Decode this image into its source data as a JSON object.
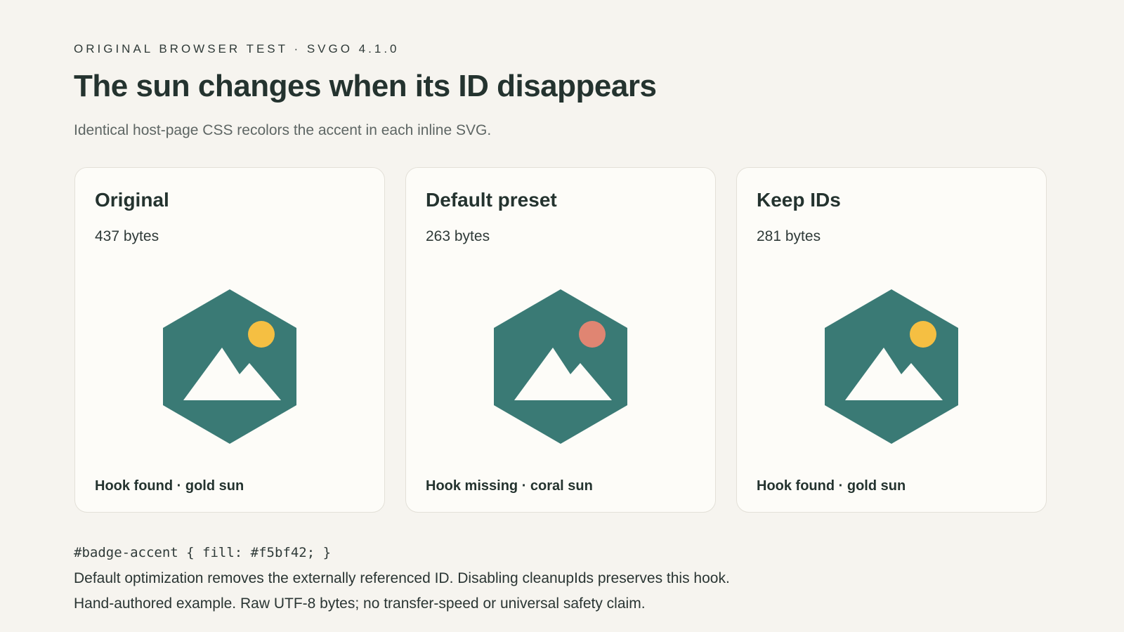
{
  "header": {
    "eyebrow": "ORIGINAL BROWSER TEST · SVGO 4.1.0",
    "title": "The sun changes when its ID disappears",
    "subtitle": "Identical host-page CSS recolors the accent in each inline SVG."
  },
  "colors": {
    "hexagon": "#3a7a75",
    "mountain": "#fdfcf8",
    "gold_sun": "#f5bf42",
    "coral_sun": "#e08572"
  },
  "cards": [
    {
      "title": "Original",
      "bytes": "437 bytes",
      "status": "Hook found · gold sun",
      "sun_color": "#f5bf42",
      "icon": "mountain-badge-icon"
    },
    {
      "title": "Default preset",
      "bytes": "263 bytes",
      "status": "Hook missing · coral sun",
      "sun_color": "#e08572",
      "icon": "mountain-badge-icon"
    },
    {
      "title": "Keep IDs",
      "bytes": "281 bytes",
      "status": "Hook found · gold sun",
      "sun_color": "#f5bf42",
      "icon": "mountain-badge-icon"
    }
  ],
  "footer": {
    "code": "#badge-accent { fill: #f5bf42; }",
    "note1": "Default optimization removes the externally referenced ID. Disabling cleanupIds preserves this hook.",
    "note2": "Hand-authored example. Raw UTF-8 bytes; no transfer-speed or universal safety claim."
  }
}
